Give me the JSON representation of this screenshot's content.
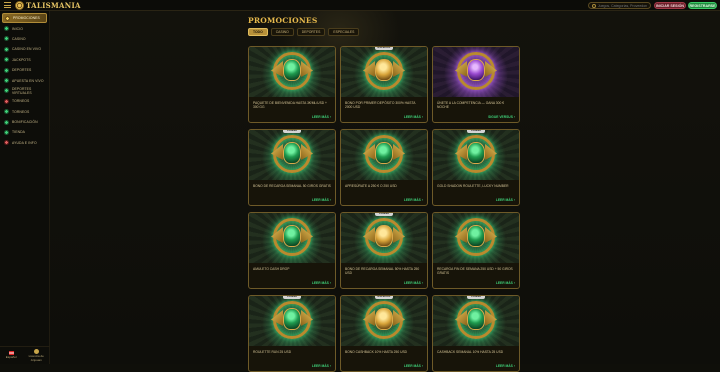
{
  "header": {
    "logo_text": "TALISMANIA",
    "search_placeholder": "Juegos, Categorías, Proveedores",
    "login_label": "INICIAR SESIÓN",
    "register_label": "REGISTRARSE"
  },
  "sidebar": {
    "items": [
      {
        "label": "PROMOCIONES",
        "icon": "gift-icon",
        "active": true
      },
      {
        "label": "INICIO",
        "icon": "home-icon"
      },
      {
        "label": "CASINO",
        "icon": "casino-icon"
      },
      {
        "label": "CASINO EN VIVO",
        "icon": "live-casino-icon"
      },
      {
        "label": "JACKPOTS",
        "icon": "jackpot-icon"
      },
      {
        "label": "DEPORTES",
        "icon": "sports-icon"
      },
      {
        "label": "APUESTA EN VIVO",
        "icon": "live-bet-icon"
      },
      {
        "label": "DEPORTES VIRTUALES",
        "icon": "virtual-sports-icon"
      },
      {
        "label": "TORNEOS",
        "icon": "trophy-icon"
      },
      {
        "label": "TORNEOS",
        "icon": "tournament-icon"
      },
      {
        "label": "BONIFICACIÓN",
        "icon": "bonus-icon"
      },
      {
        "label": "TIENDA",
        "icon": "shop-icon"
      },
      {
        "label": "AYUDA E INFO",
        "icon": "help-icon"
      }
    ],
    "bottom": {
      "language": "Español",
      "license": "Licencia de Anjouan"
    }
  },
  "main": {
    "title": "PROMOCIONES",
    "tabs": [
      {
        "label": "TODO",
        "active": true
      },
      {
        "label": "CASINO"
      },
      {
        "label": "DEPORTES"
      },
      {
        "label": "ESPECIALES"
      }
    ],
    "more_label": "LEER MÁS",
    "more_icon": "chevron-right-icon"
  },
  "promos": [
    {
      "title": "PAQUETE DE BIENVENIDA HASTA 3€/ML/USD + 300 GG",
      "style": "green",
      "badge": "",
      "more": "LEER MÁS"
    },
    {
      "title": "BONO POR PRIMER DEPÓSITO 300% HASTA 2000 USD",
      "style": "gold",
      "badge": "ESPECIAL",
      "more": "LEER MÁS"
    },
    {
      "title": "ÚNETE A LA COMPETENCIA — GANA 300 € NOCHE",
      "style": "purple",
      "badge": "",
      "more": "SIGUE VERSUS"
    },
    {
      "title": "BONO DE RECARGA SEMANAL 50 GIROS GRATIS",
      "style": "green",
      "badge": "CASINO",
      "more": "LEER MÁS"
    },
    {
      "title": "APRESÚRATE A 250 € O 250 USD",
      "style": "green",
      "badge": "",
      "more": "LEER MÁS"
    },
    {
      "title": "GOLD SHADOW ROULETTE, LUCKY NUMBER",
      "style": "green",
      "badge": "CASINO",
      "more": "LEER MÁS"
    },
    {
      "title": "AMULETO CASH DROP",
      "style": "green",
      "badge": "",
      "more": "LEER MÁS"
    },
    {
      "title": "BONO DE RECARGA SEMANAL 50% HASTA 250 USD",
      "style": "gold",
      "badge": "CASINO",
      "more": "LEER MÁS"
    },
    {
      "title": "RECARGA FIN DE SEMANA 250 USD + 50 GIROS GRATIS",
      "style": "green",
      "badge": "",
      "more": "LEER MÁS"
    },
    {
      "title": "ROULETTE RUN 25 USD",
      "style": "green",
      "badge": "CASINO",
      "more": "LEER MÁS"
    },
    {
      "title": "BONO CASHBACK 10% HASTA 250 USD",
      "style": "gold",
      "badge": "ESPECIAL",
      "more": "LEER MÁS"
    },
    {
      "title": "CASHBACK SEMANAL 10% HASTA 25 USD",
      "style": "green",
      "badge": "CASINO",
      "more": "LEER MÁS"
    }
  ],
  "colors": {
    "accent_gold": "#e6b94c",
    "register_green": "#1f8a3e",
    "login_red": "#6b1f2a",
    "more_link": "#3fd27a"
  }
}
